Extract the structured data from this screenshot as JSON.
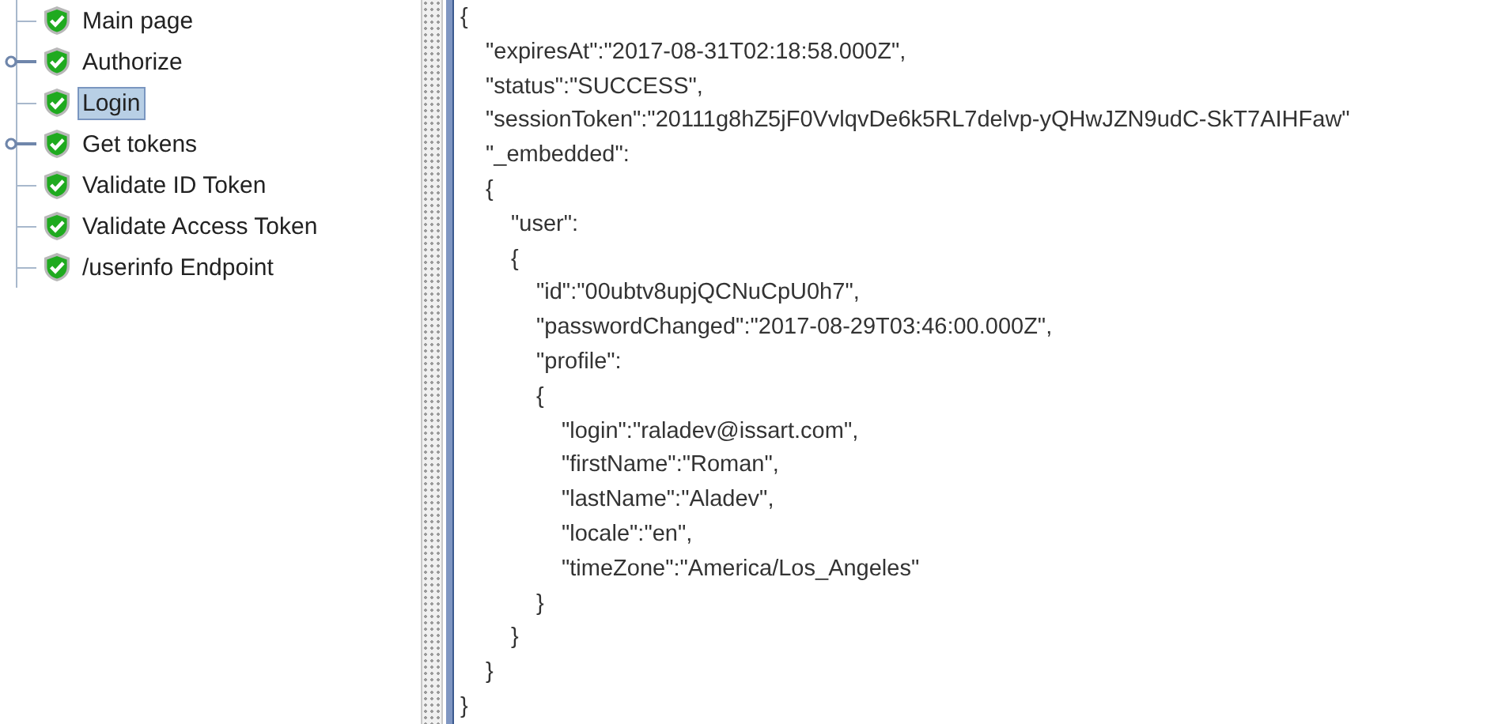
{
  "tree": {
    "items": [
      {
        "label": "Main page",
        "selected": false,
        "collapsed": false
      },
      {
        "label": "Authorize",
        "selected": false,
        "collapsed": true
      },
      {
        "label": "Login",
        "selected": true,
        "collapsed": false
      },
      {
        "label": "Get tokens",
        "selected": false,
        "collapsed": true
      },
      {
        "label": "Validate ID Token",
        "selected": false,
        "collapsed": false
      },
      {
        "label": "Validate Access Token",
        "selected": false,
        "collapsed": false
      },
      {
        "label": "/userinfo Endpoint",
        "selected": false,
        "collapsed": false
      }
    ]
  },
  "response": {
    "lines": [
      {
        "text": "{",
        "children": [
          {
            "text": "\"expiresAt\":\"2017-08-31T02:18:58.000Z\","
          },
          {
            "text": "\"status\":\"SUCCESS\","
          },
          {
            "text": "\"sessionToken\":\"20111g8hZ5jF0VvlqvDe6k5RL7delvp-yQHwJZN9udC-SkT7AIHFaw\""
          },
          {
            "text": "\"_embedded\":"
          },
          {
            "text": "{",
            "children": [
              {
                "text": "\"user\":"
              },
              {
                "text": "{",
                "children": [
                  {
                    "text": "\"id\":\"00ubtv8upjQCNuCpU0h7\","
                  },
                  {
                    "text": "\"passwordChanged\":\"2017-08-29T03:46:00.000Z\","
                  },
                  {
                    "text": "\"profile\":"
                  },
                  {
                    "text": "{",
                    "children": [
                      {
                        "text": "\"login\":\"raladev@issart.com\","
                      },
                      {
                        "text": "\"firstName\":\"Roman\","
                      },
                      {
                        "text": "\"lastName\":\"Aladev\","
                      },
                      {
                        "text": "\"locale\":\"en\","
                      },
                      {
                        "text": "\"timeZone\":\"America/Los_Angeles\""
                      }
                    ]
                  },
                  {
                    "text": "}"
                  }
                ]
              },
              {
                "text": "}"
              }
            ]
          },
          {
            "text": "}"
          }
        ]
      },
      {
        "text": "}"
      }
    ]
  }
}
